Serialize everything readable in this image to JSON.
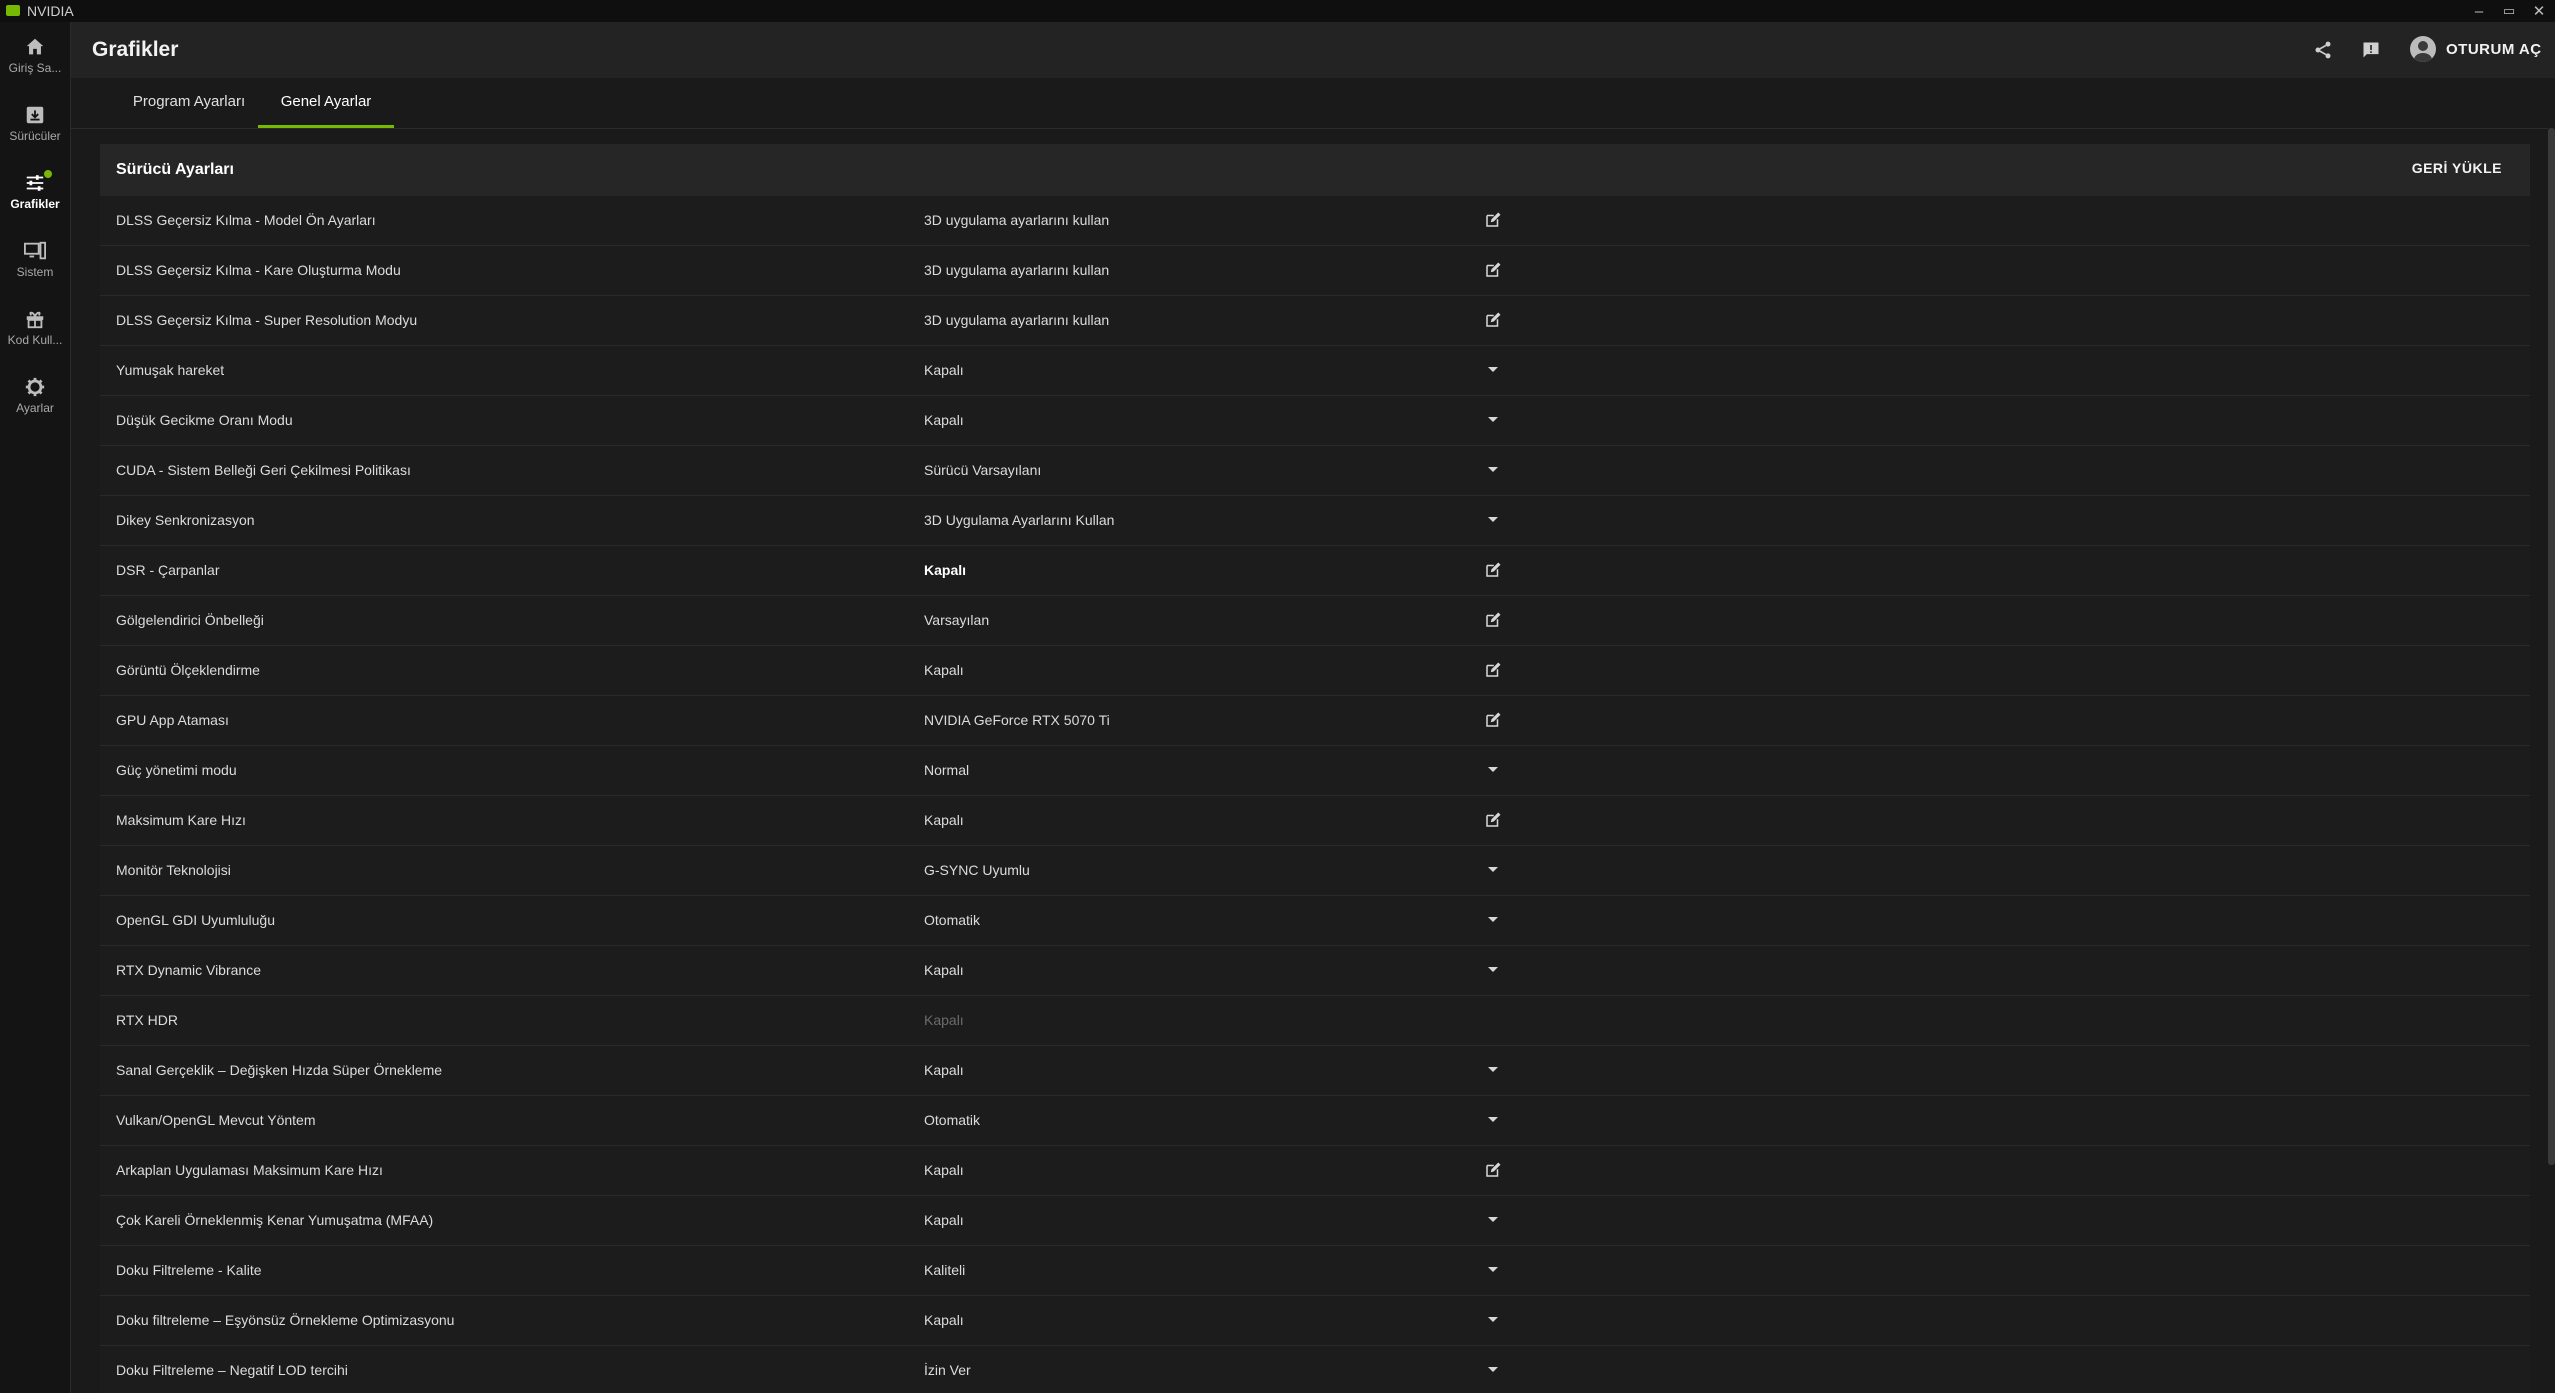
{
  "app": {
    "name": "NVIDIA"
  },
  "window_controls": {
    "minimize": "–",
    "maximize": "▭",
    "close": "✕"
  },
  "sidebar": {
    "items": [
      {
        "label": "Giriş Sa...",
        "icon": "home-icon",
        "active": false
      },
      {
        "label": "Sürücüler",
        "icon": "download-box-icon",
        "active": false
      },
      {
        "label": "Grafikler",
        "icon": "sliders-icon",
        "active": true,
        "badge": true
      },
      {
        "label": "Sistem",
        "icon": "monitor-icon",
        "active": false
      },
      {
        "label": "Kod Kull...",
        "icon": "gift-icon",
        "active": false
      },
      {
        "label": "Ayarlar",
        "icon": "gear-icon",
        "active": false
      }
    ]
  },
  "header": {
    "title": "Grafikler",
    "signin_label": "OTURUM AÇ"
  },
  "tabs": [
    {
      "label": "Program Ayarları",
      "active": false
    },
    {
      "label": "Genel Ayarlar",
      "active": true
    }
  ],
  "panel": {
    "title": "Sürücü Ayarları",
    "reset_label": "GERİ YÜKLE",
    "rows": [
      {
        "name": "DLSS Geçersiz Kılma - Model Ön Ayarları",
        "value": "3D uygulama ayarlarını kullan",
        "control": "edit"
      },
      {
        "name": "DLSS Geçersiz Kılma - Kare Oluşturma Modu",
        "value": "3D uygulama ayarlarını kullan",
        "control": "edit"
      },
      {
        "name": "DLSS Geçersiz Kılma - Super Resolution Modyu",
        "value": "3D uygulama ayarlarını kullan",
        "control": "edit"
      },
      {
        "name": "Yumuşak hareket",
        "value": "Kapalı",
        "control": "dropdown"
      },
      {
        "name": "Düşük Gecikme Oranı Modu",
        "value": "Kapalı",
        "control": "dropdown"
      },
      {
        "name": "CUDA - Sistem Belleği Geri Çekilmesi Politikası",
        "value": "Sürücü Varsayılanı",
        "control": "dropdown"
      },
      {
        "name": "Dikey Senkronizasyon",
        "value": "3D Uygulama Ayarlarını Kullan",
        "control": "dropdown"
      },
      {
        "name": "DSR - Çarpanlar",
        "value": "Kapalı",
        "control": "edit",
        "style": "bold"
      },
      {
        "name": "Gölgelendirici Önbelleği",
        "value": "Varsayılan",
        "control": "edit"
      },
      {
        "name": "Görüntü Ölçeklendirme",
        "value": "Kapalı",
        "control": "edit"
      },
      {
        "name": "GPU App Ataması",
        "value": "NVIDIA GeForce RTX 5070 Ti",
        "control": "edit"
      },
      {
        "name": "Güç yönetimi modu",
        "value": "Normal",
        "control": "dropdown"
      },
      {
        "name": "Maksimum Kare Hızı",
        "value": "Kapalı",
        "control": "edit"
      },
      {
        "name": "Monitör Teknolojisi",
        "value": "G-SYNC Uyumlu",
        "control": "dropdown"
      },
      {
        "name": "OpenGL GDI Uyumluluğu",
        "value": "Otomatik",
        "control": "dropdown"
      },
      {
        "name": "RTX Dynamic Vibrance",
        "value": "Kapalı",
        "control": "dropdown"
      },
      {
        "name": "RTX HDR",
        "value": "Kapalı",
        "control": "none",
        "style": "disabled"
      },
      {
        "name": "Sanal Gerçeklik – Değişken Hızda Süper Örnekleme",
        "value": "Kapalı",
        "control": "dropdown"
      },
      {
        "name": "Vulkan/OpenGL Mevcut Yöntem",
        "value": "Otomatik",
        "control": "dropdown"
      },
      {
        "name": "Arkaplan Uygulaması Maksimum Kare Hızı",
        "value": "Kapalı",
        "control": "edit"
      },
      {
        "name": "Çok Kareli Örneklenmiş Kenar Yumuşatma (MFAA)",
        "value": "Kapalı",
        "control": "dropdown"
      },
      {
        "name": "Doku Filtreleme - Kalite",
        "value": "Kaliteli",
        "control": "dropdown"
      },
      {
        "name": "Doku filtreleme – Eşyönsüz Örnekleme Optimizasyonu",
        "value": "Kapalı",
        "control": "dropdown"
      },
      {
        "name": "Doku Filtreleme – Negatif LOD tercihi",
        "value": "İzin Ver",
        "control": "dropdown"
      }
    ]
  },
  "colors": {
    "accent": "#76b900",
    "background": "#1a1a1a",
    "header": "#232323"
  }
}
